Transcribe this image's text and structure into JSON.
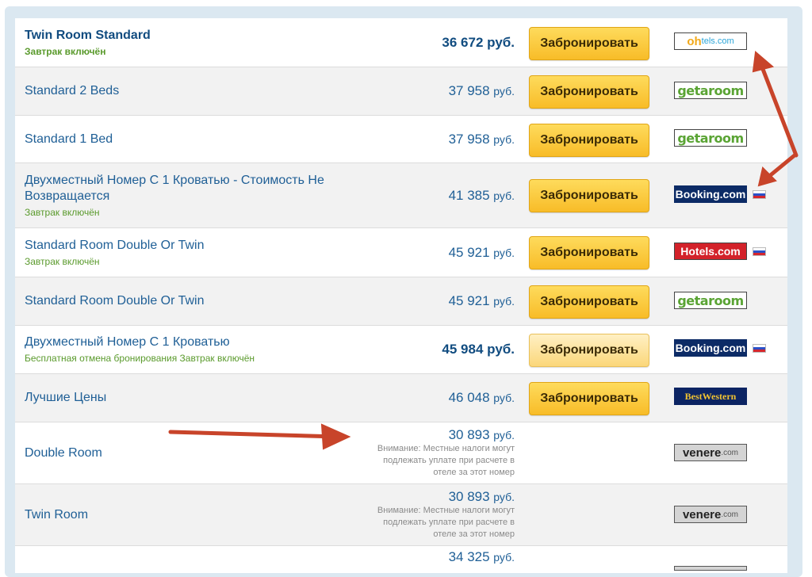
{
  "currency": "руб.",
  "book_label": "Забронировать",
  "rows": [
    {
      "name": "Twin Room Standard",
      "note": "Завтрак включён",
      "price": "36 672",
      "provider": "oh",
      "provider_label": "oh",
      "flag": false
    },
    {
      "name": "Standard 2 Beds",
      "note": "",
      "price": "37 958",
      "provider": "getaroom",
      "provider_label": "getaroom",
      "flag": false
    },
    {
      "name": "Standard 1 Bed",
      "note": "",
      "price": "37 958",
      "provider": "getaroom",
      "provider_label": "getaroom",
      "flag": false
    },
    {
      "name": "Двухместный Номер С 1 Кроватью - Стоимость Не Возвращается",
      "note": "Завтрак включён",
      "price": "41 385",
      "provider": "booking",
      "provider_label": "Booking.com",
      "flag": true
    },
    {
      "name": "Standard Room Double Or Twin",
      "note": "Завтрак включён",
      "price": "45 921",
      "provider": "hotels",
      "provider_label": "Hotels.com",
      "flag": true
    },
    {
      "name": "Standard Room Double Or Twin",
      "note": "",
      "price": "45 921",
      "provider": "getaroom",
      "provider_label": "getaroom",
      "flag": false
    },
    {
      "name": "Двухместный Номер С 1 Кроватью",
      "note": "Бесплатная отмена бронирования Завтрак включён",
      "price": "45 984",
      "provider": "booking",
      "provider_label": "Booking.com",
      "flag": true
    },
    {
      "name": "Лучшие Цены",
      "note": "",
      "price": "46 048",
      "provider": "bestwestern",
      "provider_label": "BestWestern",
      "flag": false
    },
    {
      "name": "Double Room",
      "note": "",
      "price": "30 893",
      "tax_note": "Внимание: Местные налоги могут подлежать уплате при расчете в отеле за этот номер",
      "provider": "venere",
      "provider_label": "venere",
      "flag": false
    },
    {
      "name": "Twin Room",
      "note": "",
      "price": "30 893",
      "tax_note": "Внимание: Местные налоги могут подлежать уплате при расчете в отеле за этот номер",
      "provider": "venere",
      "provider_label": "venere",
      "flag": false
    },
    {
      "name": "",
      "note": "",
      "price": "34 325",
      "provider": "",
      "provider_label": "",
      "flag": false
    }
  ],
  "logo_suffix": ".com"
}
